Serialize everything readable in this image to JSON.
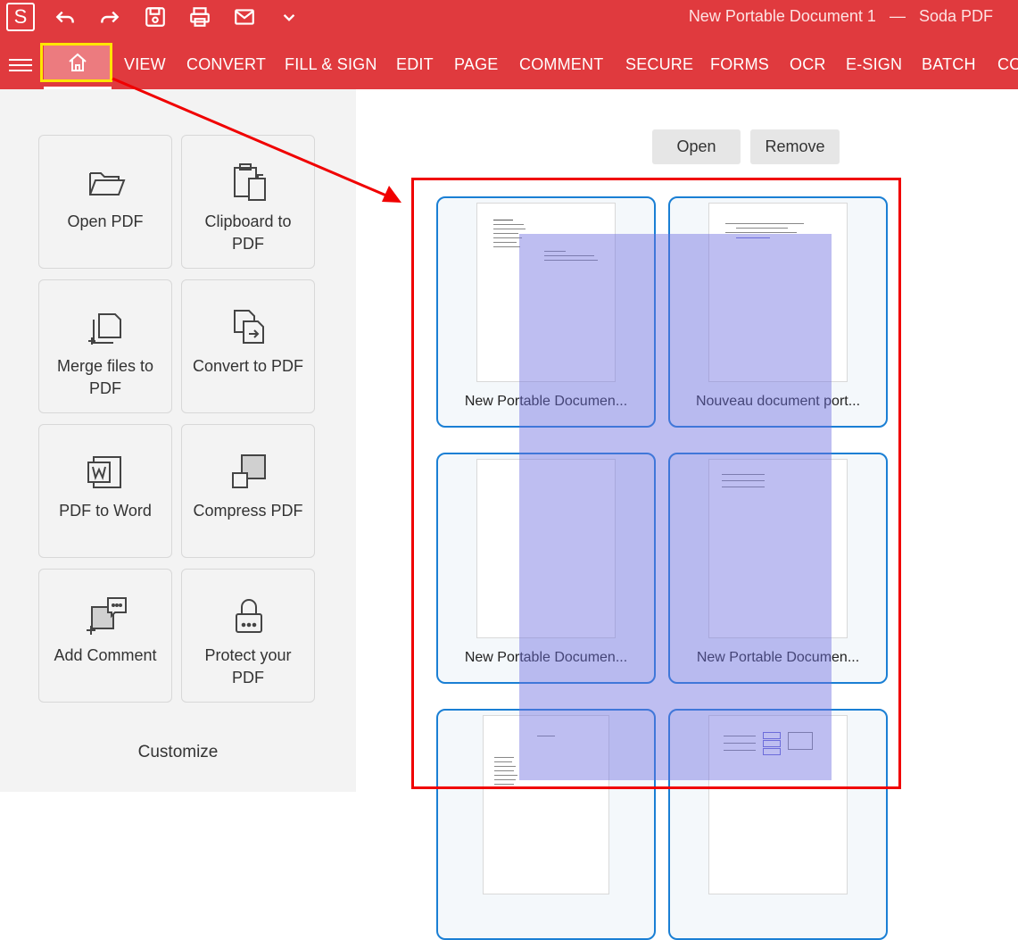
{
  "app": {
    "logo_letter": "S",
    "document_title": "New Portable Document 1",
    "separator": "—",
    "app_name": "Soda PDF"
  },
  "quick_access": [
    "undo-icon",
    "redo-icon",
    "save-icon",
    "print-icon",
    "email-icon",
    "chevron-down-icon"
  ],
  "ribbon": {
    "tabs": [
      "VIEW",
      "CONVERT",
      "FILL & SIGN",
      "EDIT",
      "PAGE",
      "COMMENT",
      "SECURE",
      "FORMS",
      "OCR",
      "E-SIGN",
      "BATCH",
      "CO"
    ]
  },
  "home_cards": [
    {
      "label": "Open PDF",
      "icon": "folder-open-icon"
    },
    {
      "label": "Clipboard to PDF",
      "icon": "clipboard-icon"
    },
    {
      "label": "Merge files to PDF",
      "icon": "merge-files-icon"
    },
    {
      "label": "Convert to PDF",
      "icon": "convert-icon"
    },
    {
      "label": "PDF to Word",
      "icon": "word-icon"
    },
    {
      "label": "Compress PDF",
      "icon": "compress-icon"
    },
    {
      "label": "Add Comment",
      "icon": "comment-icon"
    },
    {
      "label": "Protect your PDF",
      "icon": "lock-icon"
    }
  ],
  "customize_label": "Customize",
  "recent": {
    "open_label": "Open",
    "remove_label": "Remove",
    "files": [
      "New Portable Documen...",
      "Nouveau document port...",
      "New Portable Documen...",
      "New Portable Documen...",
      "",
      ""
    ]
  },
  "colors": {
    "ribbon_red": "#e03a3e",
    "highlight_yellow": "#ffe600",
    "annotation_red": "#f00000",
    "tile_blue": "#1a7fd4",
    "selection_overlay": "#6e6ee1"
  }
}
